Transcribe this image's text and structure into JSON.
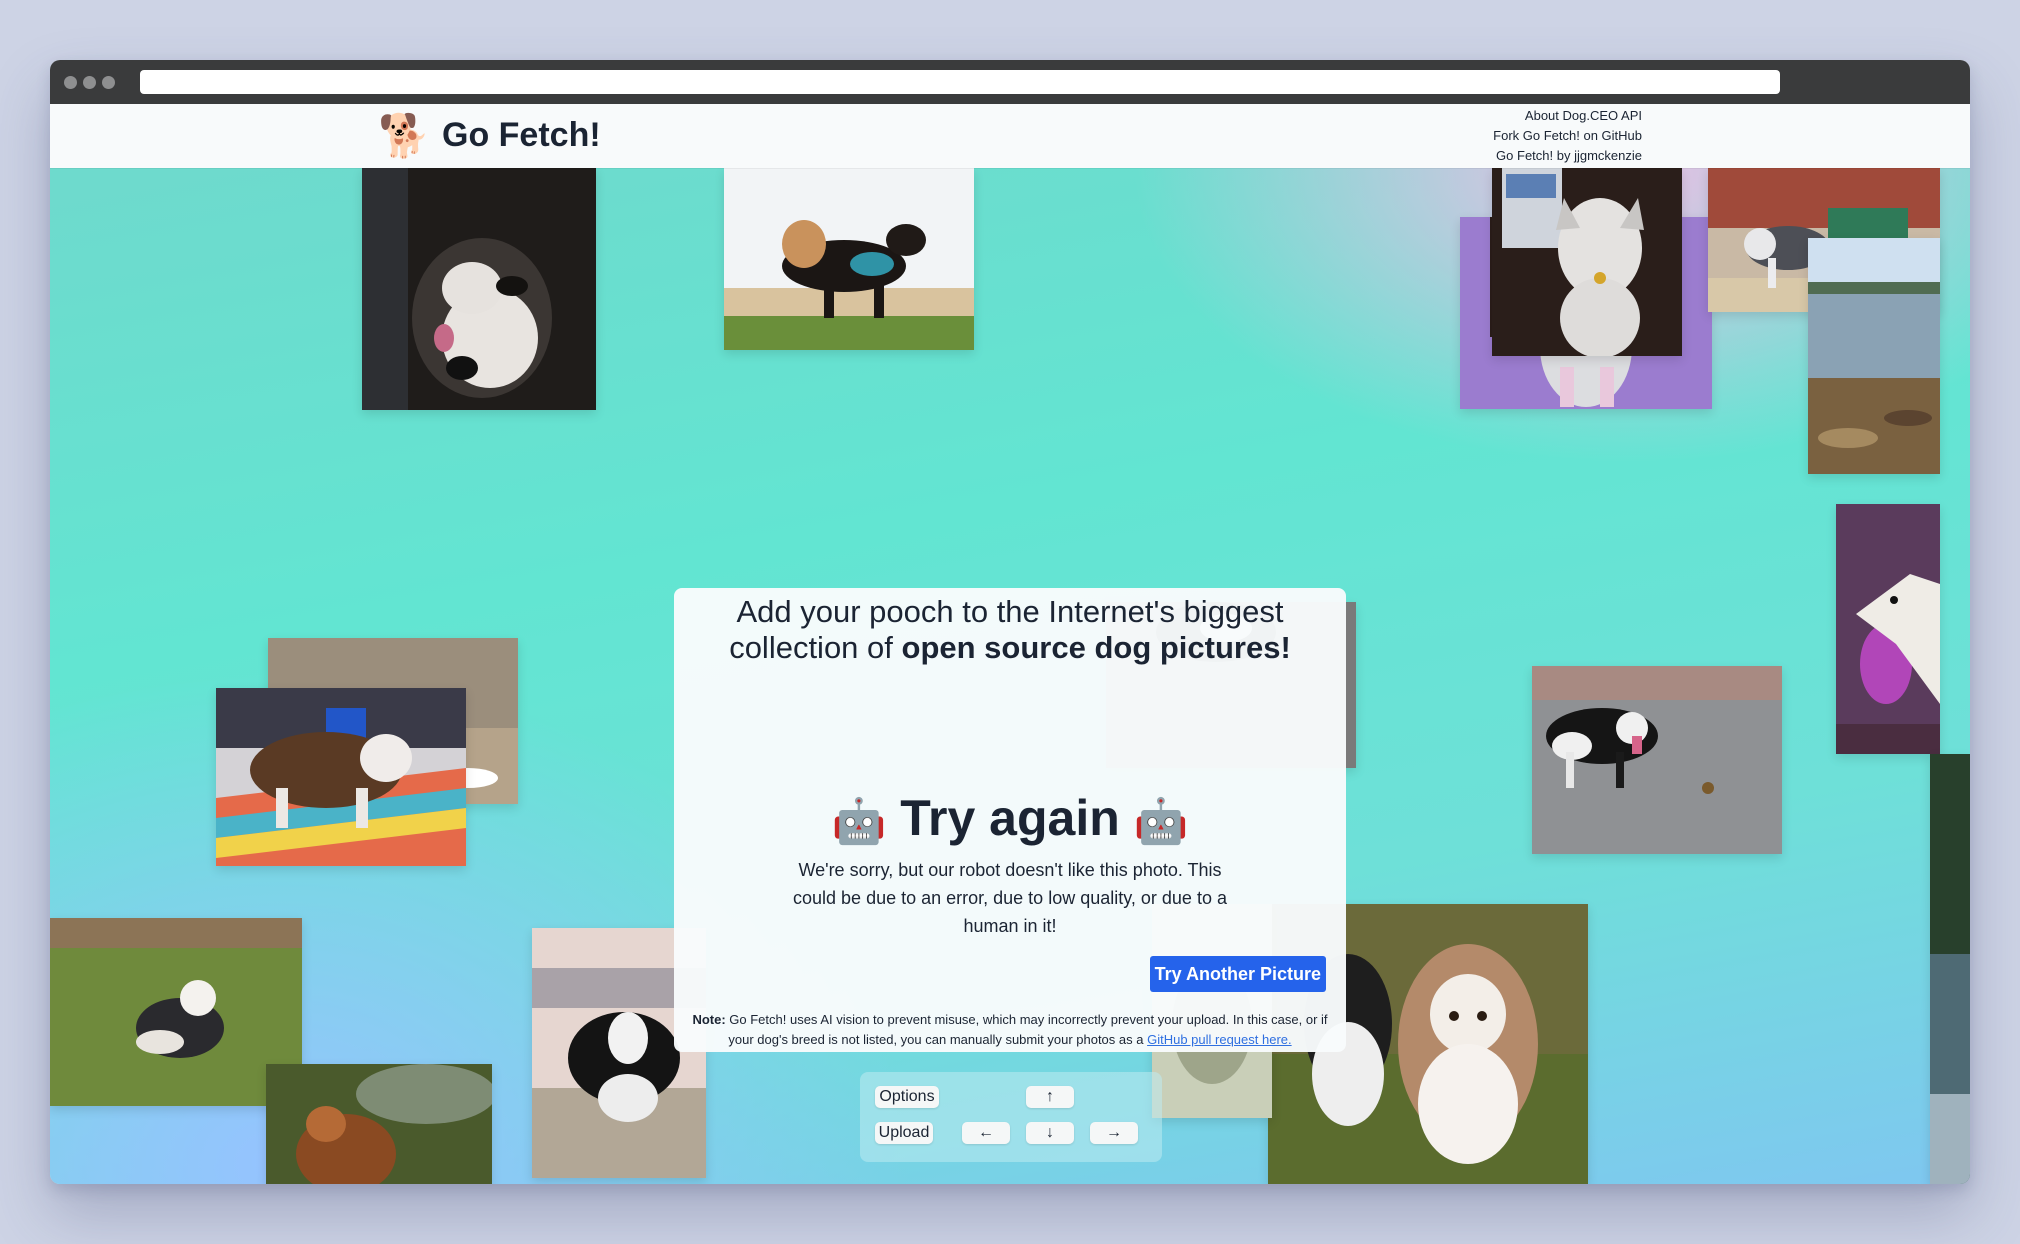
{
  "header": {
    "logo_emoji": "🐕",
    "title": "Go Fetch!",
    "links": [
      "About Dog.CEO API",
      "Fork Go Fetch! on GitHub",
      "Go Fetch! by jjgmckenzie"
    ]
  },
  "card": {
    "headline_prefix": "Add your pooch to the Internet's biggest collection of ",
    "headline_bold": "open source dog pictures!",
    "robot_emoji": "🤖",
    "try_title": "Try again",
    "apology": "We're sorry, but our robot doesn't like this photo. This could be due to an error, due to low quality, or due to a human in it!",
    "button_label": "Try Another Picture",
    "note_label": "Note:",
    "note_text": " Go Fetch! uses AI vision to prevent misuse, which may incorrectly prevent your upload. In this case, or if your dog's breed is not listed, you can manually submit your photos as a ",
    "note_link": "GitHub pull request here."
  },
  "controls": {
    "options_label": "Options",
    "upload_label": "Upload",
    "up_arrow": "↑",
    "left_arrow": "←",
    "down_arrow": "↓",
    "right_arrow": "→"
  },
  "colors": {
    "accent": "#2563eb",
    "text": "#1b2433",
    "link": "#2f6fe0"
  }
}
